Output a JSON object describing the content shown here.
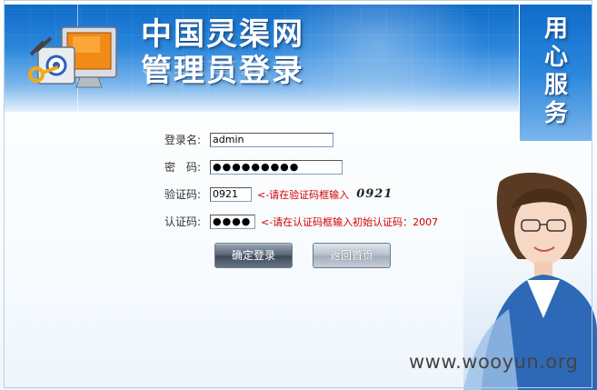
{
  "header": {
    "title_line1": "中国灵渠网",
    "title_line2": "管理员登录"
  },
  "side": {
    "chars": [
      "用",
      "心",
      "服",
      "务"
    ]
  },
  "form": {
    "username": {
      "label": "登录名:",
      "value": "admin"
    },
    "password": {
      "label": "密　码:",
      "value": "●●●●●●●●●"
    },
    "captcha": {
      "label": "验证码:",
      "value": "0921",
      "hint": "<-请在验证码框输入",
      "image_text": "0921"
    },
    "auth_code": {
      "label": "认证码:",
      "value": "●●●●",
      "hint": "<-请在认证码框输入初始认证码：2007"
    }
  },
  "buttons": {
    "login": "确定登录",
    "home": "返回首页"
  },
  "watermark": "www.wooyun.org",
  "colors": {
    "banner_blue": "#0f6cc8",
    "hint_red": "#d40000"
  }
}
